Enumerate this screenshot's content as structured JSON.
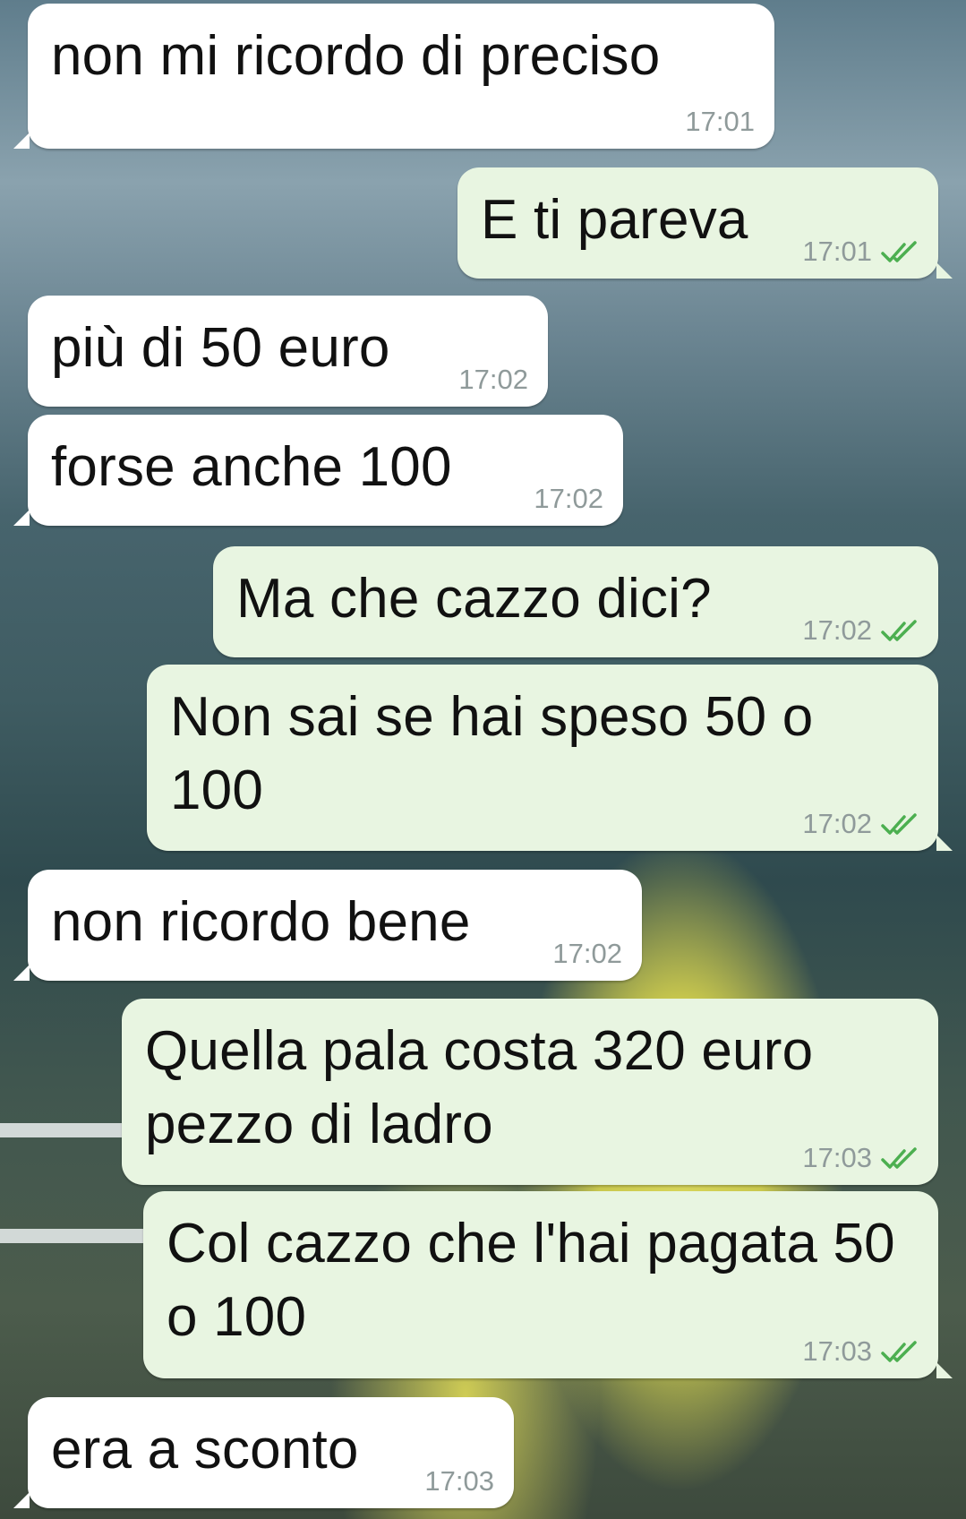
{
  "messages": [
    {
      "direction": "in",
      "text": "non mi ricordo di preciso",
      "time": "17:01"
    },
    {
      "direction": "out",
      "text": "E ti pareva",
      "time": "17:01",
      "read": true
    },
    {
      "direction": "in",
      "text": "più di 50 euro",
      "time": "17:02"
    },
    {
      "direction": "in",
      "text": "forse anche 100",
      "time": "17:02"
    },
    {
      "direction": "out",
      "text": "Ma che cazzo dici?",
      "time": "17:02",
      "read": true
    },
    {
      "direction": "out",
      "text": "Non sai se hai speso 50 o 100",
      "time": "17:02",
      "read": true
    },
    {
      "direction": "in",
      "text": "non ricordo bene",
      "time": "17:02"
    },
    {
      "direction": "out",
      "text": "Quella pala costa 320 euro pezzo di ladro",
      "time": "17:03",
      "read": true
    },
    {
      "direction": "out",
      "text": "Col cazzo che l'hai pagata 50 o 100",
      "time": "17:03",
      "read": true
    },
    {
      "direction": "in",
      "text": "era a sconto",
      "time": "17:03"
    }
  ],
  "icons": {
    "read_receipt": "double-check-icon"
  },
  "colors": {
    "incoming_bubble": "#ffffff",
    "outgoing_bubble": "#e8f5e1",
    "timestamp": "#8f9a9a",
    "read_check": "#4caf50"
  }
}
